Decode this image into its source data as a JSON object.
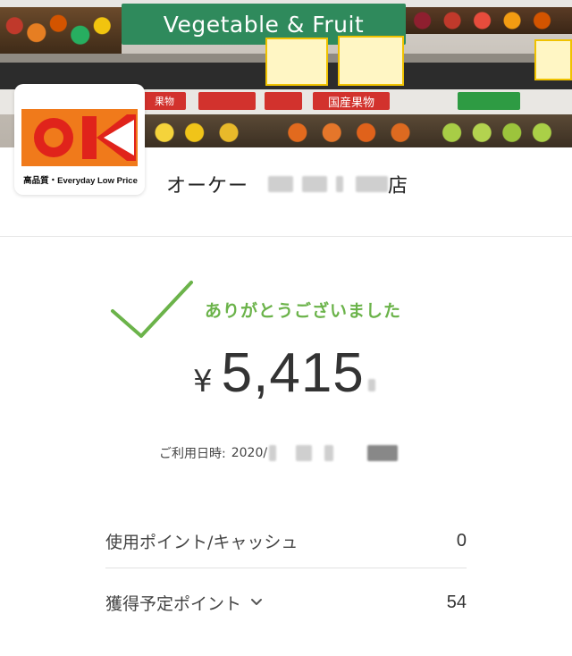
{
  "banner": {
    "sign_text": "Vegetable & Fruit",
    "shelf_tags": [
      "果物",
      "",
      "",
      "国産果物",
      ""
    ]
  },
  "brand": {
    "logo_text": "OK",
    "tagline": "高品質・Everyday Low Price",
    "colors": {
      "orange": "#F07A1B",
      "red": "#E0231B"
    }
  },
  "store": {
    "name_prefix": "オーケー",
    "name_suffix": "店"
  },
  "receipt": {
    "thanks": "ありがとうございました",
    "currency": "¥",
    "amount": "5,415",
    "usage_label": "ご利用日時:",
    "usage_value": "2020/"
  },
  "points": [
    {
      "label": "使用ポイント/キャッシュ",
      "value": "0"
    },
    {
      "label": "獲得予定ポイント",
      "value": "54"
    }
  ],
  "theme": {
    "accent_green": "#6BB34A"
  }
}
